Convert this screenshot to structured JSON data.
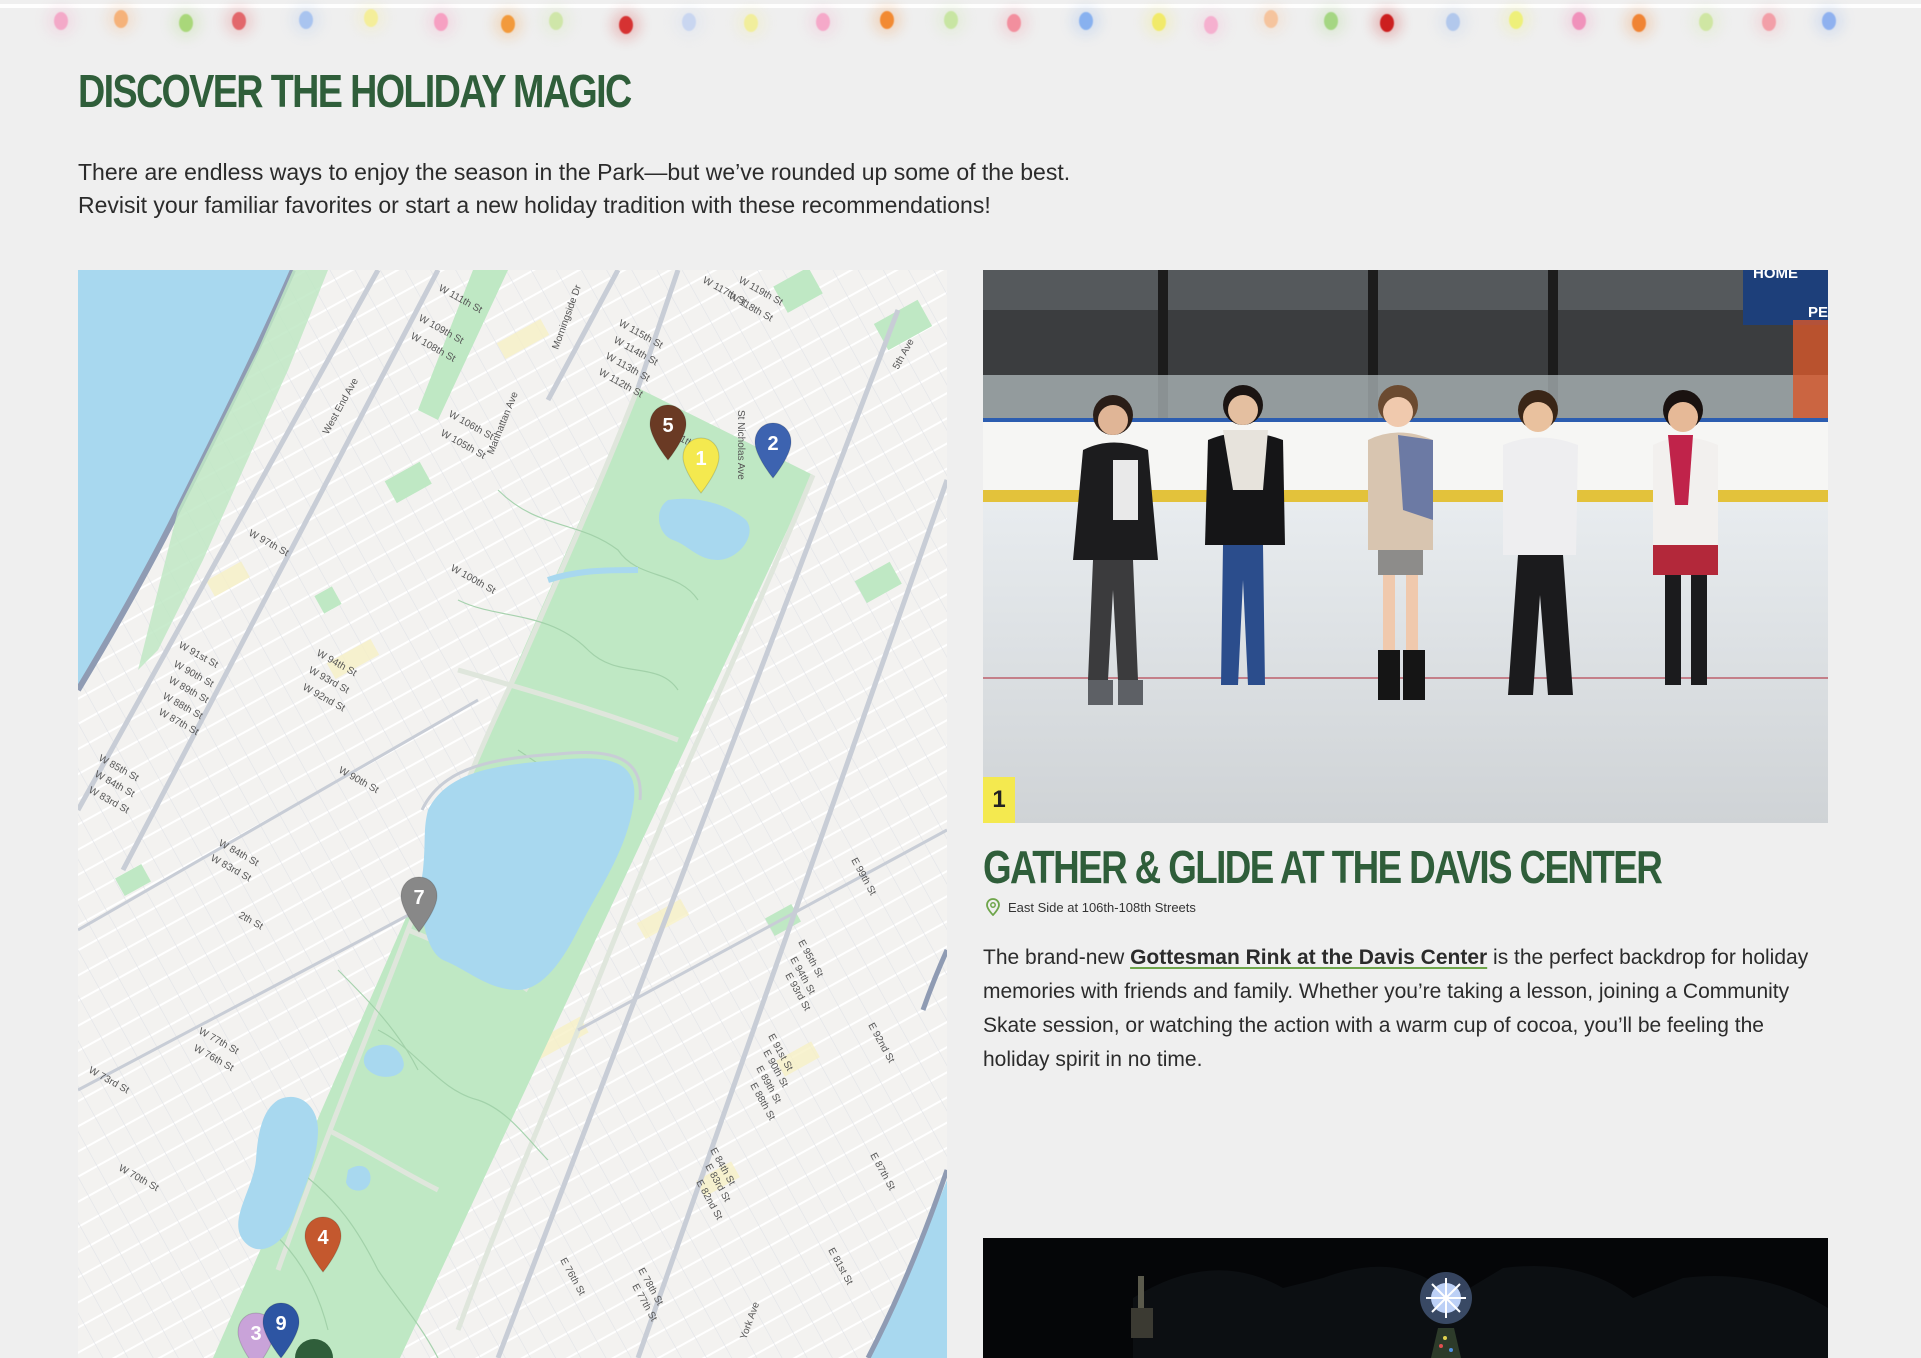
{
  "header": {
    "title": "DISCOVER THE HOLIDAY MAGIC",
    "intro_line1": "There are endless ways to enjoy the season in the Park—but we’ve rounded up some of the best.",
    "intro_line2": "Revisit your familiar favorites or start a new holiday tradition with these recommendations!"
  },
  "lights": {
    "colors": [
      "#f3a9c8",
      "#f5b27a",
      "#a9d77a",
      "#e2676b",
      "#a9c4ef",
      "#f4ee9a",
      "#f6a0c2",
      "#f29a3c",
      "#cfe6a9",
      "#d63232",
      "#c9d6f0",
      "#f1ee9c",
      "#f5a9c9",
      "#f28a32",
      "#c8e5a3",
      "#f28f9e",
      "#88b1ef",
      "#f1ea6a",
      "#f5b0cf",
      "#f5c49e",
      "#a5d683",
      "#cc1f1f",
      "#b2c8ec",
      "#eef07a",
      "#f092bb",
      "#f08434",
      "#cfe6a3",
      "#f29fa8",
      "#8fb1ef"
    ]
  },
  "map": {
    "markers": [
      {
        "label": "1",
        "color": "#f4e94f",
        "text_color": "#222"
      },
      {
        "label": "2",
        "color": "#3d63b0",
        "text_color": "#fff"
      },
      {
        "label": "3",
        "color": "#c9a3d9",
        "text_color": "#222"
      },
      {
        "label": "4",
        "color": "#c4582e",
        "text_color": "#fff"
      },
      {
        "label": "5",
        "color": "#6a3a24",
        "text_color": "#fff"
      },
      {
        "label": "7",
        "color": "#888888",
        "text_color": "#fff"
      },
      {
        "label": "9",
        "color": "#2d55a3",
        "text_color": "#fff"
      }
    ],
    "streets": [
      "W 111th St",
      "W 109th St",
      "W 108th St",
      "W 106th St",
      "W 105th St",
      "W 97th St",
      "W 100th St",
      "W 94th St",
      "W 93rd St",
      "W 92nd St",
      "W 91st St",
      "W 90th St",
      "W 89th St",
      "W 88th St",
      "W 87th St",
      "W 85th St",
      "W 84th St",
      "W 83rd St",
      "W 77th St",
      "W 76th St",
      "W 73rd St",
      "W 70th St",
      "West End Ave",
      "Morningside Dr",
      "Manhattan Ave",
      "St Nicholas Ave",
      "5th Ave",
      "W 115th St",
      "W 114th St",
      "W 113th St",
      "W 112th St",
      "W 117th St",
      "W 119th St",
      "W 118th St",
      "W 111th St",
      "E 99th St",
      "E 95th St",
      "E 94th St",
      "E 93rd St",
      "E 92nd St",
      "E 91st St",
      "E 90th St",
      "E 89th St",
      "E 88th St",
      "E 87th St",
      "E 84th St",
      "E 83rd St",
      "E 82nd St",
      "E 81st St",
      "E 76th St",
      "E 78th St",
      "E 77th St",
      "York Ave",
      "W 90th St",
      "W 84th St",
      "W 83rd St",
      "2th St"
    ],
    "colors": {
      "park": "#bfe8c4",
      "water": "#a8d8ef",
      "land": "#f1f0ee",
      "road": "#ffffff",
      "major_road": "#c8cdd6"
    }
  },
  "card1": {
    "number": "1",
    "title": "GATHER & GLIDE AT THE DAVIS CENTER",
    "location": "East Side at 106th-108th Streets",
    "body_before": "The brand-new ",
    "link": "Gottesman Rink at the Davis Center",
    "body_after": " is the perfect backdrop for holiday memories with friends and family. Whether you’re taking a lesson, joining a Community Skate session, or watching the action with a warm cup of cocoa, you’ll be feeling the holiday spirit in no time.",
    "scoreboard_text": "HOME",
    "scoreboard_text2": "PE"
  },
  "brand": {
    "green": "#2f5e3a",
    "yellow": "#f4e94f",
    "link_underline": "#6ea54a"
  }
}
